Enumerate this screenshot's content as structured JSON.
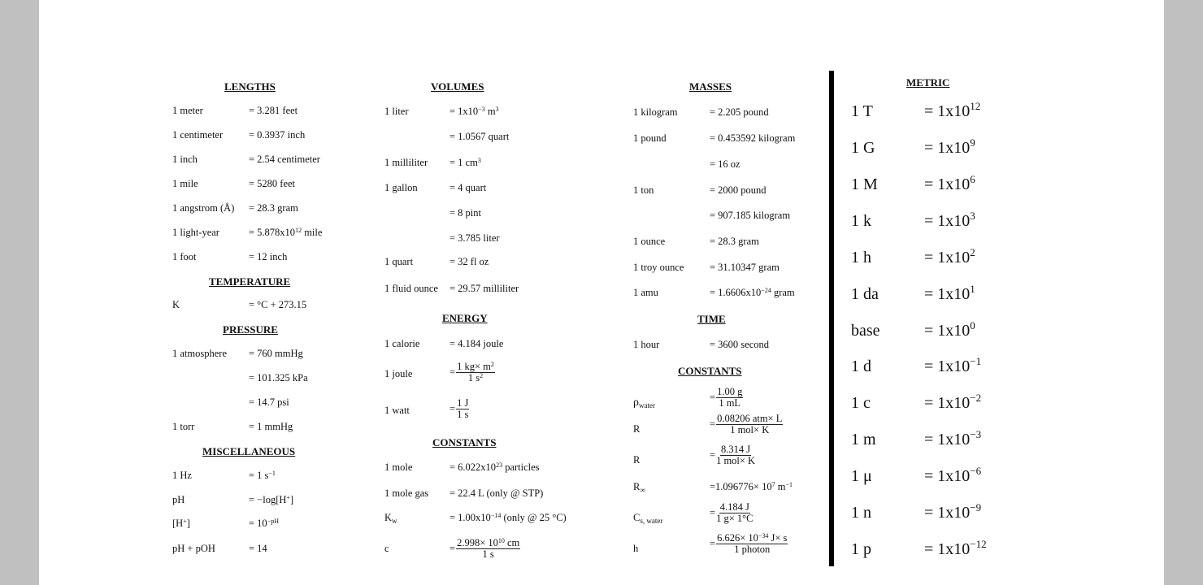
{
  "lengths": {
    "title": "LENGTHS",
    "rows": [
      {
        "label": "1 meter",
        "value": "= 3.281 feet"
      },
      {
        "label": "1 centimeter",
        "value": "= 0.3937 inch"
      },
      {
        "label": "1 inch",
        "value": "= 2.54 centimeter"
      },
      {
        "label": "1 mile",
        "value": "= 5280 feet"
      },
      {
        "label": "1 angstrom (Å)",
        "value": "= 28.3 gram"
      },
      {
        "label": "1 light-year",
        "value": "= 5.878x10",
        "sup": "12",
        "tail": " mile"
      },
      {
        "label": "1 foot",
        "value": "= 12 inch"
      }
    ]
  },
  "temperature": {
    "title": "TEMPERATURE",
    "rows": [
      {
        "label": "K",
        "value": "= °C + 273.15"
      }
    ]
  },
  "pressure": {
    "title": "PRESSURE",
    "rows": [
      {
        "label": "1 atmosphere",
        "value": "= 760 mmHg"
      },
      {
        "label": "",
        "value": "= 101.325 kPa"
      },
      {
        "label": "",
        "value": "= 14.7 psi"
      },
      {
        "label": "1 torr",
        "value": "= 1 mmHg"
      }
    ]
  },
  "misc": {
    "title": "MISCELLANEOUS",
    "rows": [
      {
        "label": "1 Hz",
        "value": "= 1 s",
        "sup": "−1"
      },
      {
        "label": "pH",
        "value": "= −log[H",
        "sup": "+",
        "tail": "]"
      },
      {
        "label": "[H",
        "label_sup": "+",
        "label_tail": "]",
        "value": "= 10",
        "sup": "−pH"
      },
      {
        "label": "pH + pOH",
        "value": "= 14"
      }
    ]
  },
  "volumes": {
    "title": "VOLUMES",
    "rows": [
      {
        "label": "1 liter",
        "value": "= 1x10",
        "sup": "−3",
        "tail": " m",
        "sup2": "3"
      },
      {
        "label": "",
        "value": "= 1.0567 quart"
      },
      {
        "label": "1 milliliter",
        "value": "= 1 cm",
        "sup": "3"
      },
      {
        "label": "1 gallon",
        "value": "= 4 quart"
      },
      {
        "label": "",
        "value": "= 8 pint"
      },
      {
        "label": "",
        "value": "= 3.785 liter"
      },
      {
        "label": "1 quart",
        "value": "= 32 fl oz"
      },
      {
        "label": "1 fluid ounce",
        "value": "= 29.57 milliliter"
      }
    ]
  },
  "energy": {
    "title": "ENERGY",
    "rows": [
      {
        "label": "1 calorie",
        "value": "= 4.184 joule"
      },
      {
        "label": "1 joule",
        "num": "1 kg× m",
        "num_sup": "2",
        "den": "1 s",
        "den_sup": "2"
      },
      {
        "label": "1 watt",
        "num": "1 J",
        "den": "1 s"
      }
    ]
  },
  "constants_mid": {
    "title": "CONSTANTS",
    "rows": [
      {
        "label": "1 mole",
        "value": "= 6.022x10",
        "sup": "23",
        "tail": " particles"
      },
      {
        "label": "1 mole gas",
        "value": "= 22.4 L (only @ STP)"
      },
      {
        "label": "K",
        "label_sub": "w",
        "value": "= 1.00x10",
        "sup": "−14",
        "tail": " (only @ 25 °C)"
      },
      {
        "label": "c",
        "num": "2.998× 10",
        "num_sup": "10",
        "num_tail": "  cm",
        "den": "1 s"
      }
    ]
  },
  "masses": {
    "title": "MASSES",
    "rows": [
      {
        "label": "1 kilogram",
        "value": "= 2.205 pound"
      },
      {
        "label": "1 pound",
        "value": "= 0.453592 kilogram"
      },
      {
        "label": "",
        "value": "= 16 oz"
      },
      {
        "label": "1 ton",
        "value": "= 2000 pound"
      },
      {
        "label": "",
        "value": "= 907.185 kilogram"
      },
      {
        "label": "1 ounce",
        "value": "= 28.3 gram"
      },
      {
        "label": "1 troy ounce",
        "value": "= 31.10347 gram"
      },
      {
        "label": "1 amu",
        "value": "= 1.6606x10",
        "sup": "−24",
        "tail": " gram"
      }
    ]
  },
  "time": {
    "title": "TIME",
    "rows": [
      {
        "label": "1 hour",
        "value": "= 3600 second"
      }
    ]
  },
  "constants_right": {
    "title": "CONSTANTS",
    "rows": [
      {
        "label": "ρ",
        "label_sub": "water",
        "num": "1.00 g",
        "den": "1 mL"
      },
      {
        "label": "R",
        "num": "0.08206 atm× L",
        "den": "1 mol× K"
      },
      {
        "label": "R",
        "num": "8.314 J",
        "den": "1 mol× K"
      },
      {
        "label": "R",
        "label_sub": "∞",
        "value": "=1.096776× 10",
        "sup": "7",
        "tail": " m",
        "sup2": "−1"
      },
      {
        "label": "C",
        "label_sub": "s, water",
        "num": "4.184 J",
        "den": "1 g× 1°C"
      },
      {
        "label": "h",
        "num": "6.626× 10",
        "num_sup": "−34",
        "num_tail": "  J× s",
        "den": "1 photon"
      }
    ]
  },
  "metric": {
    "title": "METRIC",
    "rows": [
      {
        "label": "1 T",
        "value": "= 1x10",
        "sup": "12"
      },
      {
        "label": "1 G",
        "value": "= 1x10",
        "sup": "9"
      },
      {
        "label": "1 M",
        "value": "= 1x10",
        "sup": "6"
      },
      {
        "label": "1 k",
        "value": "= 1x10",
        "sup": "3"
      },
      {
        "label": "1 h",
        "value": "= 1x10",
        "sup": "2"
      },
      {
        "label": "1 da",
        "value": "= 1x10",
        "sup": "1"
      },
      {
        "label": "base",
        "value": "= 1x10",
        "sup": "0"
      },
      {
        "label": "1 d",
        "value": "= 1x10",
        "sup": "−1"
      },
      {
        "label": "1 c",
        "value": "= 1x10",
        "sup": "−2"
      },
      {
        "label": "1 m",
        "value": "= 1x10",
        "sup": "−3"
      },
      {
        "label": "1 μ",
        "value": "= 1x10",
        "sup": "−6"
      },
      {
        "label": "1 n",
        "value": "= 1x10",
        "sup": "−9"
      },
      {
        "label": "1 p",
        "value": "= 1x10",
        "sup": "−12"
      }
    ]
  }
}
